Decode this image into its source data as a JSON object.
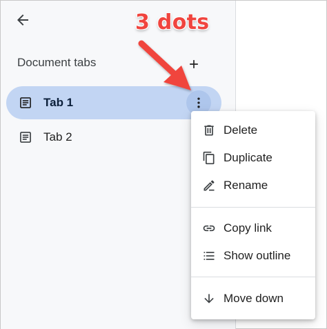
{
  "header": {
    "back_label": "Back"
  },
  "section": {
    "title": "Document tabs",
    "add_label": "Add tab"
  },
  "tabs": [
    {
      "label": "Tab 1",
      "active": true
    },
    {
      "label": "Tab 2",
      "active": false
    }
  ],
  "menu": {
    "items": [
      {
        "label": "Delete",
        "icon": "trash-icon"
      },
      {
        "label": "Duplicate",
        "icon": "copy-icon"
      },
      {
        "label": "Rename",
        "icon": "pencil-icon"
      },
      {
        "label": "Copy link",
        "icon": "link-icon"
      },
      {
        "label": "Show outline",
        "icon": "list-icon"
      },
      {
        "label": "Move down",
        "icon": "arrow-down-icon"
      }
    ]
  },
  "annotation": {
    "text": "3 dots",
    "color": "#f0443e"
  },
  "colors": {
    "active_tab_bg": "#c2d5f3",
    "more_button_bg": "#aec6ec",
    "sidebar_bg": "#f7f8fa"
  }
}
